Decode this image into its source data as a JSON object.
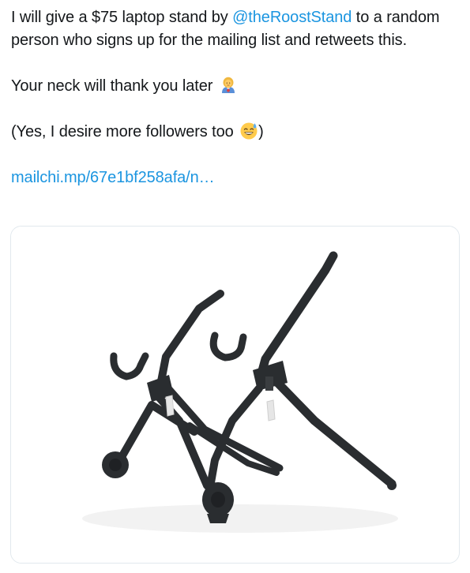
{
  "tweet": {
    "line1_pre": "I will give a $75 laptop stand by ",
    "mention": "@theRoostStand",
    "line1_post": " to a random person who signs up for the mailing list and retweets this.",
    "line2": "Your neck will thank you later ",
    "emoji1": "woman-health-worker-emoji",
    "line3_pre": "(Yes, I desire more followers too ",
    "emoji2": "grinning-sweat-emoji",
    "line3_post": ")",
    "link": "mailchi.mp/67e1bf258afa/n…"
  },
  "card": {
    "image": "laptop-stand-photo"
  },
  "colors": {
    "text": "#14171a",
    "link": "#1b95e0",
    "card_border": "#e1e8ed",
    "stand": "#2a2d30"
  }
}
